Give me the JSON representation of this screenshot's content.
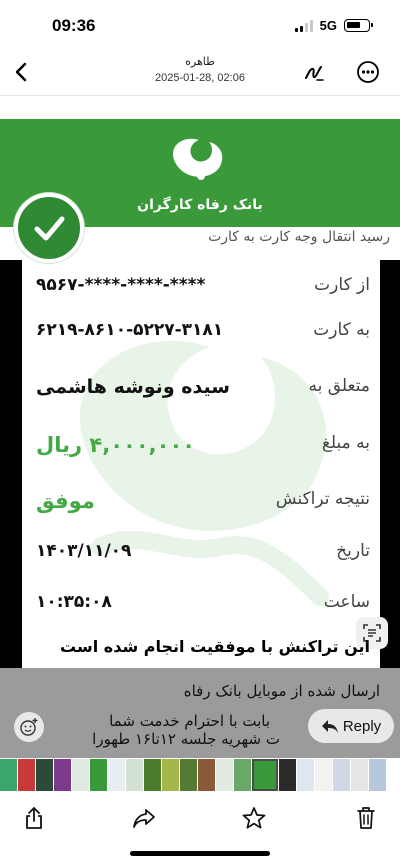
{
  "status": {
    "time": "09:36",
    "network": "5G"
  },
  "header": {
    "title": "طاهره",
    "date": "2025-01-28, 02:06"
  },
  "receipt": {
    "bank_name": "بانک رفاه کارگران",
    "subtitle": "رسید انتقال وجه کارت به کارت",
    "rows": [
      {
        "label": "از کارت",
        "value": "****-****-****-۹۵۶۷"
      },
      {
        "label": "به کارت",
        "value": "۶۲۱۹-۸۶۱۰-۵۲۲۷-۳۱۸۱"
      },
      {
        "label": "متعلق به",
        "value": "سیده ونوشه  هاشمی"
      },
      {
        "label": "به مبلغ",
        "value": "۴,۰۰۰,۰۰۰ ریال"
      },
      {
        "label": "نتیجه تراکنش",
        "value": "موفق"
      },
      {
        "label": "تاریخ",
        "value": "۱۴۰۳/۱۱/۰۹"
      },
      {
        "label": "ساعت",
        "value": "۱۰:۳۵:۰۸"
      }
    ],
    "footer_line": "این تراکنش با موفقیت انجام شده است"
  },
  "overlay": {
    "line1": "ارسال شده از موبایل بانک رفاه",
    "line2": "بابت با احترام خدمت  شما",
    "line3": "ت  شهریه جلسه ۱۲تا۱۶ طهورا",
    "reply_label": "Reply"
  },
  "colors": {
    "bank_green": "#3a9a3a",
    "amount_green": "#44a844",
    "overlay_gray": "#9b9b9b"
  },
  "icons": [
    "back-chevron-icon",
    "markup-pen-icon",
    "more-icon",
    "check-icon",
    "scan-text-icon",
    "reply-arrow-icon",
    "add-reaction-icon",
    "share-icon",
    "forward-icon",
    "star-icon",
    "trash-icon"
  ]
}
